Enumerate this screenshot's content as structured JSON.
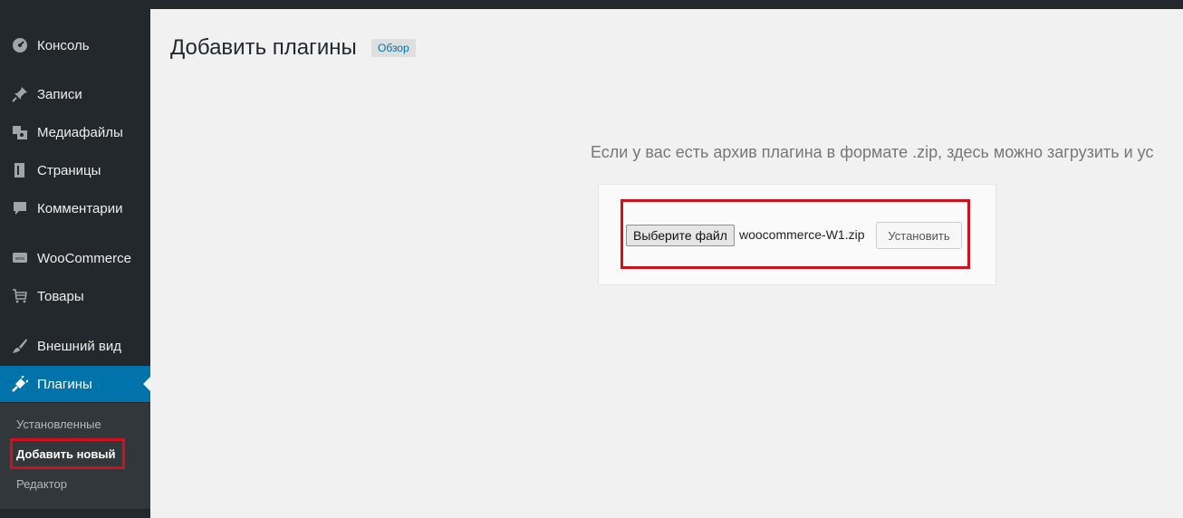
{
  "sidebar": {
    "items": [
      {
        "label": "Консоль",
        "icon": "dashboard-icon"
      },
      {
        "label": "Записи",
        "icon": "pushpin-icon"
      },
      {
        "label": "Медиафайлы",
        "icon": "media-icon"
      },
      {
        "label": "Страницы",
        "icon": "pages-icon"
      },
      {
        "label": "Комментарии",
        "icon": "comment-icon"
      },
      {
        "label": "WooCommerce",
        "icon": "woo-icon"
      },
      {
        "label": "Товары",
        "icon": "cart-icon"
      },
      {
        "label": "Внешний вид",
        "icon": "brush-icon"
      },
      {
        "label": "Плагины",
        "icon": "plugin-icon"
      }
    ],
    "submenu": [
      {
        "label": "Установленные"
      },
      {
        "label": "Добавить новый"
      },
      {
        "label": "Редактор"
      }
    ]
  },
  "header": {
    "title": "Добавить плагины",
    "browse_label": "Обзор"
  },
  "upload": {
    "description": "Если у вас есть архив плагина в формате .zip, здесь можно загрузить и ус",
    "choose_file_label": "Выберите файл",
    "file_name": "woocommerce-W1.zip",
    "install_label": "Установить"
  },
  "colors": {
    "sidebar_bg": "#23282d",
    "active_bg": "#0073aa",
    "highlight": "#d0111b"
  }
}
